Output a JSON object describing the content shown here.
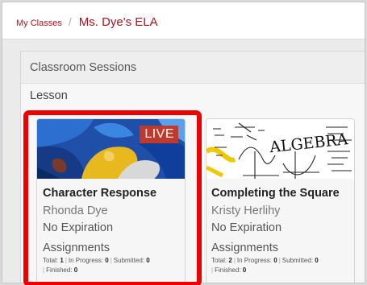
{
  "breadcrumb": {
    "parent": "My Classes",
    "separator": "/",
    "current": "Ms. Dye's ELA"
  },
  "panel": {
    "header": "Classroom Sessions",
    "section_label": "Lesson"
  },
  "cards": [
    {
      "badge": "LIVE",
      "title": "Character Response",
      "teacher": "Rhonda Dye",
      "expiry": "No Expiration",
      "assignments_label": "Assignments",
      "stats": {
        "total_label": "Total:",
        "total": "1",
        "in_progress_label": "In Progress:",
        "in_progress": "0",
        "submitted_label": "Submitted:",
        "submitted": "0",
        "finished_label": "Finished:",
        "finished": "0"
      },
      "highlighted": true
    },
    {
      "thumb_text": "ALGEBRA",
      "title": "Completing the Square",
      "teacher": "Kristy Herlihy",
      "expiry": "No Expiration",
      "assignments_label": "Assignments",
      "stats": {
        "total_label": "Total:",
        "total": "2",
        "in_progress_label": "In Progress:",
        "in_progress": "0",
        "submitted_label": "Submitted:",
        "submitted": "0",
        "finished_label": "Finished:",
        "finished": "0"
      }
    }
  ],
  "colors": {
    "brand_red": "#b5121b",
    "live_badge": "#c0392b",
    "highlight": "#ee0000"
  }
}
